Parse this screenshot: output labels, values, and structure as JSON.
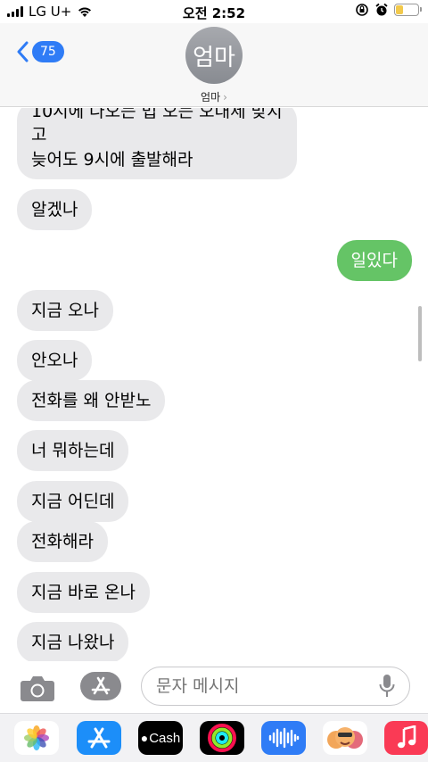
{
  "status_bar": {
    "carrier": "LG U+",
    "time": "오전 2:52",
    "battery_level": 0.35
  },
  "header": {
    "back_badge": "75",
    "avatar_text": "엄마",
    "contact_name": "엄마"
  },
  "messages": [
    {
      "direction": "in",
      "text": "10시에 나오는 법 오는 오대세 맞지"
    },
    {
      "direction": "in",
      "text": "고"
    },
    {
      "direction": "in",
      "text": "늦어도 9시에 출발해라"
    },
    {
      "direction": "in",
      "text": "알겠나"
    },
    {
      "direction": "out",
      "text": "일있다"
    },
    {
      "direction": "in",
      "text": "지금 오나"
    },
    {
      "direction": "in",
      "text": "안오나"
    },
    {
      "direction": "in",
      "text": "전화를 왜 안받노"
    },
    {
      "direction": "in",
      "text": "너 뭐하는데"
    },
    {
      "direction": "in",
      "text": "지금 어딘데"
    },
    {
      "direction": "in",
      "text": "전화해라"
    },
    {
      "direction": "in",
      "text": "지금 바로 온나"
    },
    {
      "direction": "in",
      "text": "지금 나왔나"
    }
  ],
  "input": {
    "placeholder": "문자 메시지"
  },
  "app_strip": {
    "cash_label": "Cash",
    "apps": [
      "photos-icon",
      "app-store-icon",
      "apple-cash-icon",
      "activity-icon",
      "audio-message-icon",
      "memoji-icon",
      "music-icon"
    ]
  },
  "colors": {
    "accent": "#2f7cf6",
    "outgoing_bubble": "#65c466",
    "incoming_bubble": "#e9e9eb"
  }
}
